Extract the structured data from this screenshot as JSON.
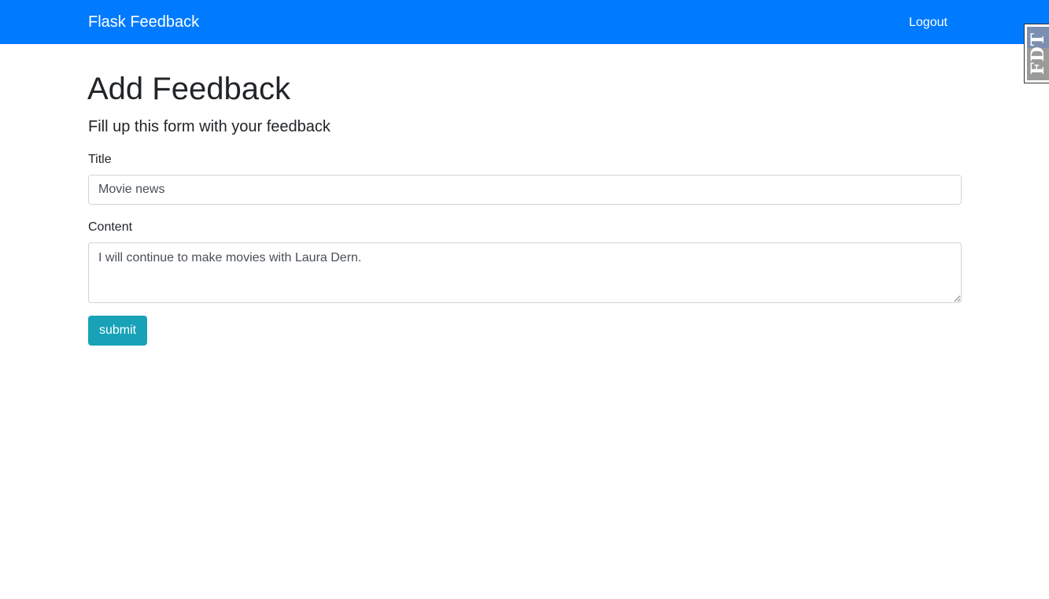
{
  "navbar": {
    "brand": "Flask Feedback",
    "logout_label": "Logout",
    "color": "#007bff"
  },
  "side_tab": {
    "label": "FDT"
  },
  "main": {
    "title": "Add Feedback",
    "subtitle": "Fill up this form with your feedback"
  },
  "form": {
    "title_label": "Title",
    "title_value": "Movie news",
    "content_label": "Content",
    "content_value": "I will continue to make movies with Laura Dern.",
    "submit_label": "submit",
    "submit_color": "#17a2b8"
  }
}
